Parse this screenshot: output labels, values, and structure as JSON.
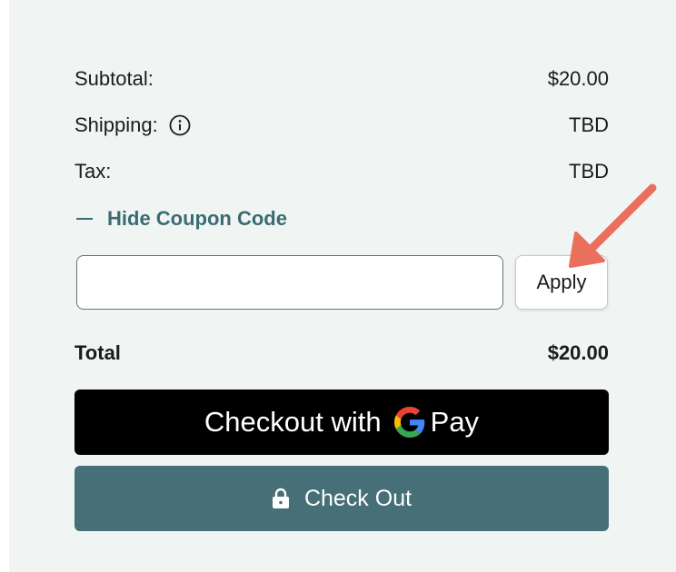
{
  "summary": {
    "subtotal_label": "Subtotal:",
    "subtotal_value": "$20.00",
    "shipping_label": "Shipping:",
    "shipping_value": "TBD",
    "tax_label": "Tax:",
    "tax_value": "TBD",
    "total_label": "Total",
    "total_value": "$20.00"
  },
  "coupon": {
    "toggle_label": "Hide Coupon Code",
    "input_value": "",
    "apply_label": "Apply"
  },
  "actions": {
    "gpay_prefix": "Checkout with",
    "gpay_brand": "Pay",
    "checkout_label": "Check Out"
  },
  "icons": {
    "shipping_info": "info-icon",
    "coupon_toggle": "minus-icon",
    "gpay_logo": "google-g-icon",
    "checkout": "lock-icon",
    "annotation": "arrow-icon"
  },
  "colors": {
    "panel_background": "#f0f5f4",
    "accent": "#3b6b73",
    "checkout_button": "#466f77",
    "gpay_button": "#000000",
    "annotation_arrow": "#e8705d"
  }
}
